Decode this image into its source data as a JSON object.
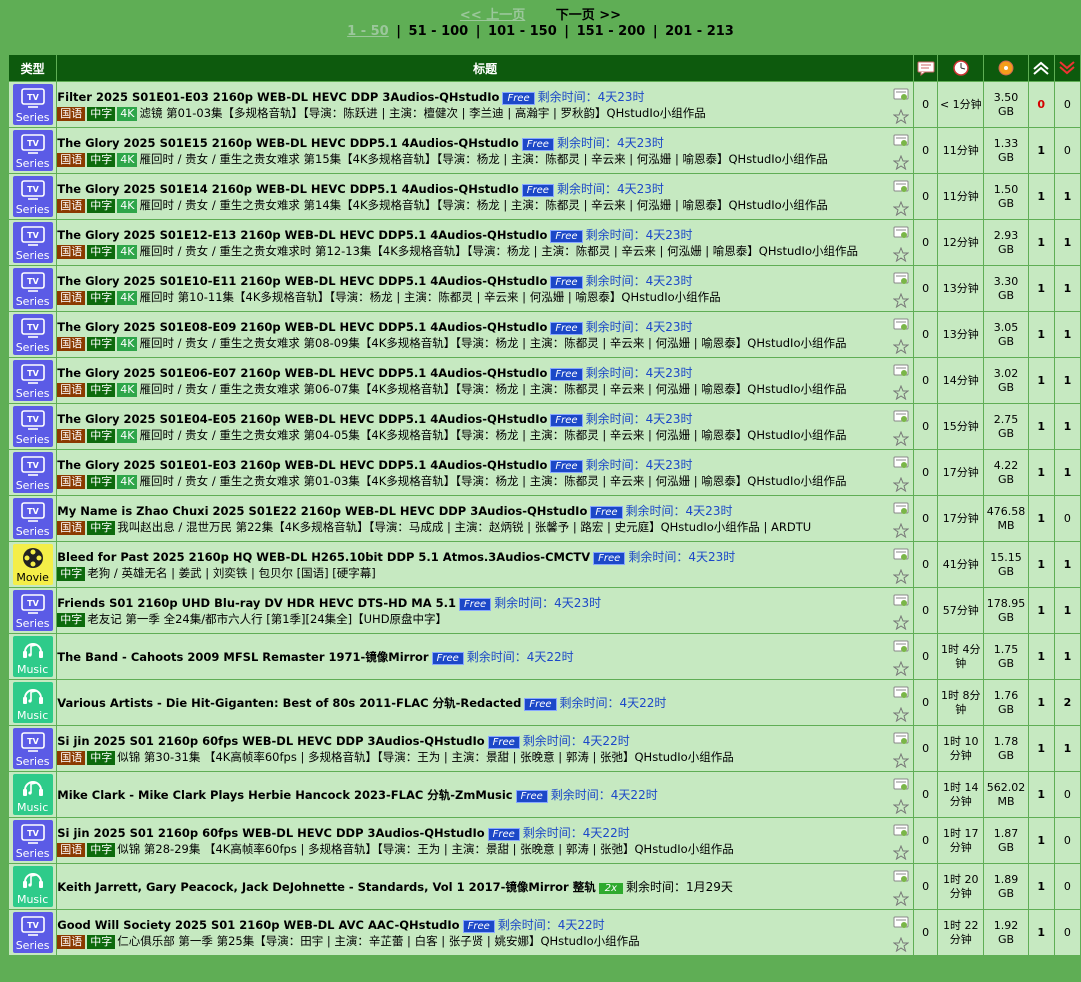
{
  "pager": {
    "prev": "<< 上一页",
    "next": "下一页 >>",
    "current": "1 - 50",
    "pages": [
      "51 - 100",
      "101 - 150",
      "151 - 200",
      "201 - 213"
    ]
  },
  "headers": {
    "type": "类型",
    "title": "标题"
  },
  "colors": {
    "header_bg": "#0d5a0d",
    "row_bg": "#c6e9c1",
    "page_bg": "#5fae55",
    "free_badge": "#1c48c8",
    "tv": "#5b5be6",
    "movie": "#f4ee48",
    "music": "#2ecb8a"
  },
  "rows": [
    {
      "cat": "tv",
      "cat_label": "Series",
      "title": "Filter 2025 S01E01-E03 2160p WEB-DL HEVC DDP 3Audios-QHstudIo",
      "badge": "Free",
      "left": "剩余时间：4天23时",
      "tags": [
        "国语",
        "中字",
        "4K"
      ],
      "desc": "滤镜 第01-03集【多规格音轨】【导演：陈跃进 | 主演：檀健次 | 李兰迪 | 高瀚宇 | 罗秋韵】QHstudIo小组作品",
      "comments": "0",
      "time": "< 1分钟",
      "size": "3.50 GB",
      "seeders": "0",
      "seeders_red": true,
      "leechers": "0"
    },
    {
      "cat": "tv",
      "cat_label": "Series",
      "title": "The Glory 2025 S01E15 2160p WEB-DL HEVC DDP5.1 4Audios-QHstudIo",
      "badge": "Free",
      "left": "剩余时间：4天23时",
      "tags": [
        "国语",
        "中字",
        "4K"
      ],
      "desc": "雁回时 / 贵女 / 重生之贵女难求 第15集【4K多规格音轨】【导演：杨龙 | 主演：陈都灵 | 辛云来 | 何泓姗 | 喻恩泰】QHstudIo小组作品",
      "comments": "0",
      "time": "11分钟",
      "size": "1.33 GB",
      "seeders": "1",
      "leechers": "0"
    },
    {
      "cat": "tv",
      "cat_label": "Series",
      "title": "The Glory 2025 S01E14 2160p WEB-DL HEVC DDP5.1 4Audios-QHstudIo",
      "badge": "Free",
      "left": "剩余时间：4天23时",
      "tags": [
        "国语",
        "中字",
        "4K"
      ],
      "desc": "雁回时 / 贵女 / 重生之贵女难求 第14集【4K多规格音轨】【导演：杨龙 | 主演：陈都灵 | 辛云来 | 何泓姗 | 喻恩泰】QHstudIo小组作品",
      "comments": "0",
      "time": "11分钟",
      "size": "1.50 GB",
      "seeders": "1",
      "leechers": "1"
    },
    {
      "cat": "tv",
      "cat_label": "Series",
      "title": "The Glory 2025 S01E12-E13 2160p WEB-DL HEVC DDP5.1 4Audios-QHstudIo",
      "badge": "Free",
      "left": "剩余时间：4天23时",
      "tags": [
        "国语",
        "中字",
        "4K"
      ],
      "desc": "雁回时 / 贵女 / 重生之贵女难求时 第12-13集【4K多规格音轨】【导演：杨龙 | 主演：陈都灵 | 辛云来 | 何泓姗 | 喻恩泰】QHstudIo小组作品",
      "comments": "0",
      "time": "12分钟",
      "size": "2.93 GB",
      "seeders": "1",
      "leechers": "1"
    },
    {
      "cat": "tv",
      "cat_label": "Series",
      "title": "The Glory 2025 S01E10-E11 2160p WEB-DL HEVC DDP5.1 4Audios-QHstudIo",
      "badge": "Free",
      "left": "剩余时间：4天23时",
      "tags": [
        "国语",
        "中字",
        "4K"
      ],
      "desc": "雁回时 第10-11集【4K多规格音轨】【导演：杨龙 | 主演：陈都灵 | 辛云来 | 何泓姗 | 喻恩泰】QHstudIo小组作品",
      "comments": "0",
      "time": "13分钟",
      "size": "3.30 GB",
      "seeders": "1",
      "leechers": "1"
    },
    {
      "cat": "tv",
      "cat_label": "Series",
      "title": "The Glory 2025 S01E08-E09 2160p WEB-DL HEVC DDP5.1 4Audios-QHstudIo",
      "badge": "Free",
      "left": "剩余时间：4天23时",
      "tags": [
        "国语",
        "中字",
        "4K"
      ],
      "desc": "雁回时 / 贵女 / 重生之贵女难求 第08-09集【4K多规格音轨】【导演：杨龙 | 主演：陈都灵 | 辛云来 | 何泓姗 | 喻恩泰】QHstudIo小组作品",
      "comments": "0",
      "time": "13分钟",
      "size": "3.05 GB",
      "seeders": "1",
      "leechers": "1"
    },
    {
      "cat": "tv",
      "cat_label": "Series",
      "title": "The Glory 2025 S01E06-E07 2160p WEB-DL HEVC DDP5.1 4Audios-QHstudIo",
      "badge": "Free",
      "left": "剩余时间：4天23时",
      "tags": [
        "国语",
        "中字",
        "4K"
      ],
      "desc": "雁回时 / 贵女 / 重生之贵女难求 第06-07集【4K多规格音轨】【导演：杨龙 | 主演：陈都灵 | 辛云来 | 何泓姗 | 喻恩泰】QHstudIo小组作品",
      "comments": "0",
      "time": "14分钟",
      "size": "3.02 GB",
      "seeders": "1",
      "leechers": "1"
    },
    {
      "cat": "tv",
      "cat_label": "Series",
      "title": "The Glory 2025 S01E04-E05 2160p WEB-DL HEVC DDP5.1 4Audios-QHstudIo",
      "badge": "Free",
      "left": "剩余时间：4天23时",
      "tags": [
        "国语",
        "中字",
        "4K"
      ],
      "desc": "雁回时 / 贵女 / 重生之贵女难求 第04-05集【4K多规格音轨】【导演：杨龙 | 主演：陈都灵 | 辛云来 | 何泓姗 | 喻恩泰】QHstudIo小组作品",
      "comments": "0",
      "time": "15分钟",
      "size": "2.75 GB",
      "seeders": "1",
      "leechers": "1"
    },
    {
      "cat": "tv",
      "cat_label": "Series",
      "title": "The Glory 2025 S01E01-E03 2160p WEB-DL HEVC DDP5.1 4Audios-QHstudIo",
      "badge": "Free",
      "left": "剩余时间：4天23时",
      "tags": [
        "国语",
        "中字",
        "4K"
      ],
      "desc": "雁回时 / 贵女 / 重生之贵女难求 第01-03集【4K多规格音轨】【导演：杨龙 | 主演：陈都灵 | 辛云来 | 何泓姗 | 喻恩泰】QHstudIo小组作品",
      "comments": "0",
      "time": "17分钟",
      "size": "4.22 GB",
      "seeders": "1",
      "leechers": "1"
    },
    {
      "cat": "tv",
      "cat_label": "Series",
      "title": "My Name is Zhao Chuxi 2025 S01E22 2160p WEB-DL HEVC DDP 3Audios-QHstudIo",
      "badge": "Free",
      "left": "剩余时间：4天23时",
      "tags": [
        "国语",
        "中字"
      ],
      "desc": "我叫赵出息 / 混世万民 第22集【4K多规格音轨】【导演：马成成 | 主演：赵炳锐 | 张馨予 | 路宏 | 史元庭】QHstudIo小组作品 | ARDTU",
      "comments": "0",
      "time": "17分钟",
      "size": "476.58 MB",
      "seeders": "1",
      "leechers": "0"
    },
    {
      "cat": "movie",
      "cat_label": "Movie",
      "title": "Bleed for Past 2025 2160p HQ WEB-DL H265.10bit DDP 5.1 Atmos.3Audios-CMCTV",
      "badge": "Free",
      "left": "剩余时间：4天23时",
      "tags": [
        "中字"
      ],
      "desc": "老狗 / 英雄无名 | 姜武 | 刘奕铁 | 包贝尔 [国语] [硬字幕]",
      "comments": "0",
      "time": "41分钟",
      "size": "15.15 GB",
      "seeders": "1",
      "leechers": "1"
    },
    {
      "cat": "tv",
      "cat_label": "Series",
      "title": "Friends S01 2160p UHD Blu-ray DV HDR HEVC DTS-HD MA 5.1",
      "badge": "Free",
      "left": "剩余时间：4天23时",
      "tags": [
        "中字"
      ],
      "desc": "老友记 第一季 全24集/都市六人行 [第1季][24集全]【UHD原盘中字】",
      "comments": "0",
      "time": "57分钟",
      "size": "178.95 GB",
      "seeders": "1",
      "leechers": "1"
    },
    {
      "cat": "music",
      "cat_label": "Music",
      "title": "The Band - Cahoots 2009 MFSL Remaster 1971-镜像Mirror",
      "badge": "Free",
      "left": "剩余时间：4天22时",
      "tags": [],
      "desc": "",
      "comments": "0",
      "time": "1时 4分钟",
      "size": "1.75 GB",
      "seeders": "1",
      "leechers": "1"
    },
    {
      "cat": "music",
      "cat_label": "Music",
      "title": "Various Artists - Die Hit-Giganten: Best of 80s 2011-FLAC 分轨-Redacted",
      "badge": "Free",
      "left": "剩余时间：4天22时",
      "tags": [],
      "desc": "",
      "comments": "0",
      "time": "1时 8分钟",
      "size": "1.76 GB",
      "seeders": "1",
      "leechers": "2"
    },
    {
      "cat": "tv",
      "cat_label": "Series",
      "title": "Si jin 2025 S01 2160p 60fps WEB-DL HEVC DDP 3Audios-QHstudIo",
      "badge": "Free",
      "left": "剩余时间：4天22时",
      "tags": [
        "国语",
        "中字"
      ],
      "desc": "似锦 第30-31集 【4K高帧率60fps | 多规格音轨】【导演：王为 | 主演：景甜 | 张晚意 | 郭涛 | 张弛】QHstudIo小组作品",
      "comments": "0",
      "time": "1时 10分钟",
      "size": "1.78 GB",
      "seeders": "1",
      "leechers": "1"
    },
    {
      "cat": "music",
      "cat_label": "Music",
      "title": "Mike Clark - Mike Clark Plays Herbie Hancock 2023-FLAC 分轨-ZmMusic",
      "badge": "Free",
      "left": "剩余时间：4天22时",
      "tags": [],
      "desc": "",
      "comments": "0",
      "time": "1时 14分钟",
      "size": "562.02 MB",
      "seeders": "1",
      "leechers": "0"
    },
    {
      "cat": "tv",
      "cat_label": "Series",
      "title": "Si jin 2025 S01 2160p 60fps WEB-DL HEVC DDP 3Audios-QHstudIo",
      "badge": "Free",
      "left": "剩余时间：4天22时",
      "tags": [
        "国语",
        "中字"
      ],
      "desc": "似锦 第28-29集 【4K高帧率60fps | 多规格音轨】【导演：王为 | 主演：景甜 | 张晚意 | 郭涛 | 张弛】QHstudIo小组作品",
      "comments": "0",
      "time": "1时 17分钟",
      "size": "1.87 GB",
      "seeders": "1",
      "leechers": "0"
    },
    {
      "cat": "music",
      "cat_label": "Music",
      "title": "Keith Jarrett, Gary Peacock, Jack DeJohnette - Standards, Vol 1 2017-镜像Mirror 整轨",
      "badge": "2x",
      "left": "剩余时间：1月29天",
      "left_black": true,
      "tags": [],
      "desc": "",
      "comments": "0",
      "time": "1时 20分钟",
      "size": "1.89 GB",
      "seeders": "1",
      "leechers": "0"
    },
    {
      "cat": "tv",
      "cat_label": "Series",
      "title": "Good Will Society 2025 S01 2160p WEB-DL AVC AAC-QHstudIo",
      "badge": "Free",
      "left": "剩余时间：4天22时",
      "tags": [
        "国语",
        "中字"
      ],
      "desc": "仁心俱乐部 第一季 第25集【导演：田宇 | 主演：辛芷蕾 | 白客 | 张子贤 | 姚安娜】QHstudIo小组作品",
      "comments": "0",
      "time": "1时 22分钟",
      "size": "1.92 GB",
      "seeders": "1",
      "leechers": "0"
    }
  ]
}
